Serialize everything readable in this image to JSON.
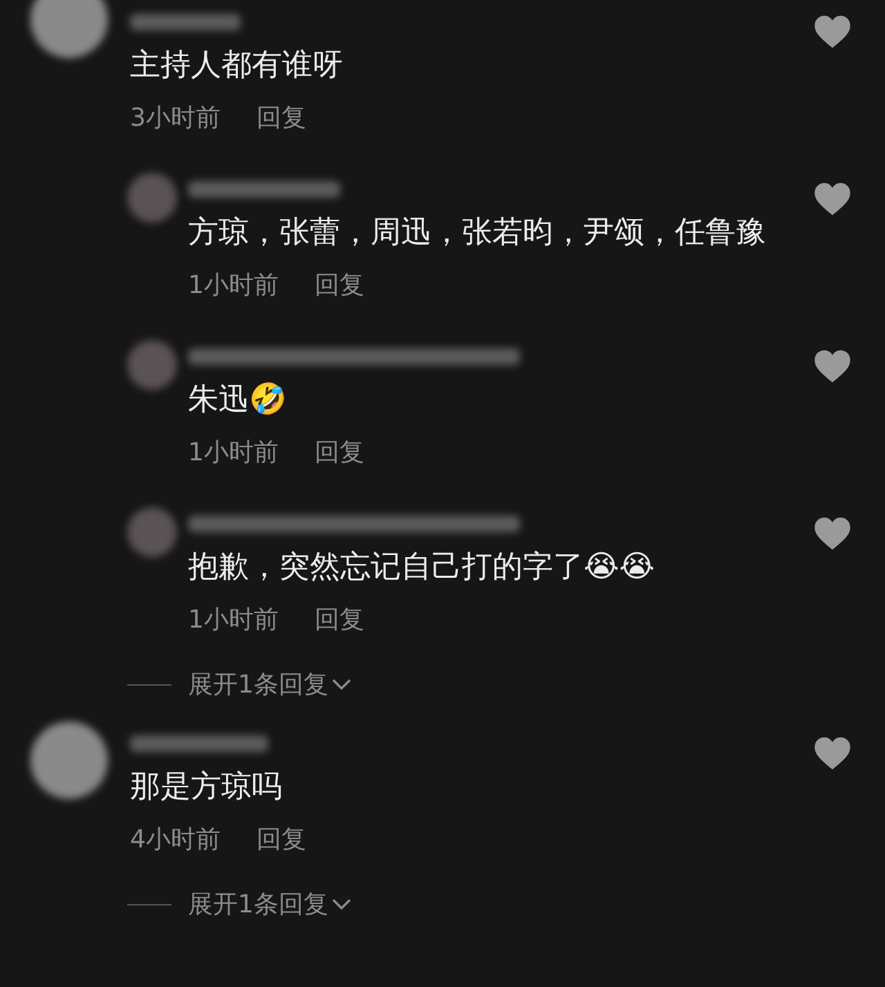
{
  "comments": [
    {
      "text": "主持人都有谁呀",
      "time": "3小时前",
      "reply_label": "回复",
      "replies": [
        {
          "text": "方琼，张蕾，周迅，张若昀，尹颂，任鲁豫",
          "time": "1小时前",
          "reply_label": "回复"
        },
        {
          "text": "朱迅🤣",
          "time": "1小时前",
          "reply_label": "回复"
        },
        {
          "text": "抱歉，突然忘记自己打的字了😭😭",
          "time": "1小时前",
          "reply_label": "回复"
        }
      ],
      "expand_label": "展开1条回复"
    },
    {
      "text": "那是方琼吗",
      "time": "4小时前",
      "reply_label": "回复",
      "expand_label": "展开1条回复"
    }
  ]
}
